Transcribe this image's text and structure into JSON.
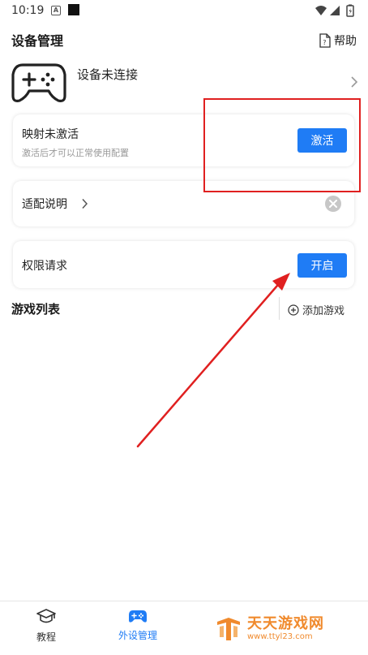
{
  "status_bar": {
    "time": "10:19",
    "notification_icon_letter": "A"
  },
  "header": {
    "title": "设备管理",
    "help_label": "帮助"
  },
  "device": {
    "status": "设备未连接"
  },
  "mapping_card": {
    "title": "映射未激活",
    "subtitle": "激活后才可以正常使用配置",
    "button_label": "激活"
  },
  "guide_card": {
    "label": "适配说明"
  },
  "permission_card": {
    "label": "权限请求",
    "button_label": "开启"
  },
  "games": {
    "title": "游戏列表",
    "add_label": "添加游戏"
  },
  "bottom_nav": {
    "items": [
      {
        "label": "教程",
        "icon": "graduation-cap-icon",
        "active": false
      },
      {
        "label": "外设管理",
        "icon": "gamepad-icon",
        "active": true
      }
    ]
  },
  "watermark": {
    "name": "天天游戏网",
    "url": "www.ttyl23.com"
  },
  "colors": {
    "accent": "#1f7cf5",
    "annotation": "#e02020",
    "watermark": "#f08a2d"
  }
}
